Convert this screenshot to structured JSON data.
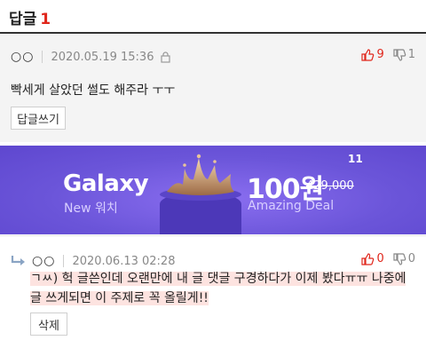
{
  "header": {
    "title": "답글",
    "count": "1"
  },
  "comment1": {
    "author": "○○",
    "date": "2020.05.19 15:36",
    "likes": "9",
    "dislikes": "1",
    "text": "빡세게 살았던 썰도 해주라 ㅜㅜ",
    "reply_button": "답글쓰기"
  },
  "banner": {
    "brand": "11",
    "product": "Galaxy",
    "subtitle": "New 워치",
    "price": "100원",
    "original_price": "429,000",
    "deal": "Amazing Deal"
  },
  "comment2": {
    "author": "○○",
    "date": "2020.06.13 02:28",
    "likes": "0",
    "dislikes": "0",
    "text": "ㄱㅆ) 헉 글쓴인데 오랜만에 내 글 댓글 구경하다가 이제 봤다ㅠㅠ 나중에 글 쓰게되면 이 주제로 꼭 올릴게!!",
    "delete_button": "삭제"
  },
  "colors": {
    "accent": "#e0261b",
    "banner": "#6b55d9",
    "highlight": "#fde3e0"
  }
}
